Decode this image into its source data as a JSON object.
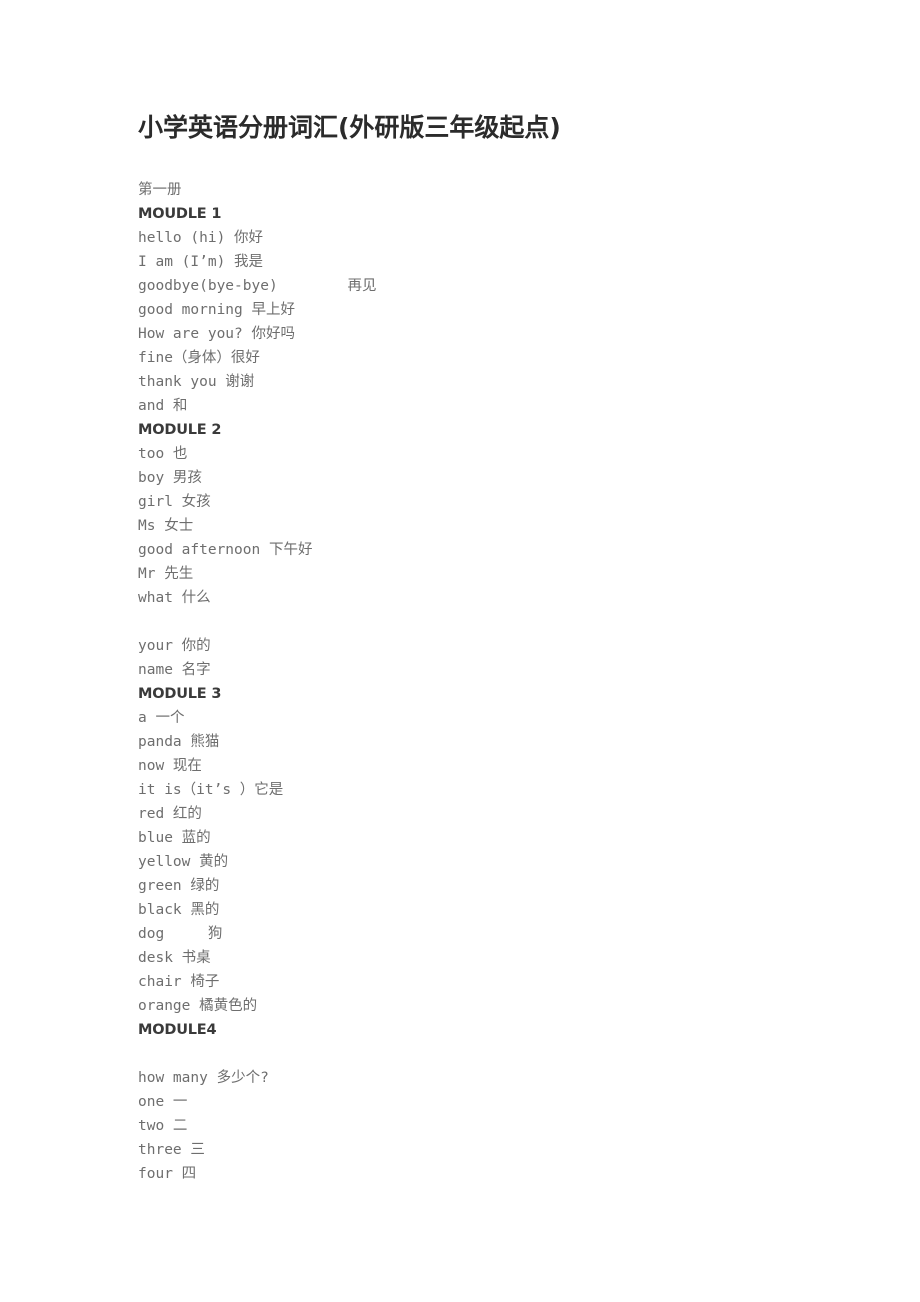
{
  "document": {
    "title": "小学英语分册词汇(外研版三年级起点)",
    "lines": [
      {
        "text": "第一册",
        "type": "normal"
      },
      {
        "text": "MOUDLE 1",
        "type": "heading"
      },
      {
        "text": "hello (hi) 你好",
        "type": "normal"
      },
      {
        "text": "I am (I’m) 我是",
        "type": "normal"
      },
      {
        "text": "goodbye(bye-bye)        再见",
        "type": "normal"
      },
      {
        "text": "good morning 早上好",
        "type": "normal"
      },
      {
        "text": "How are you? 你好吗",
        "type": "normal"
      },
      {
        "text": "fine（身体）很好",
        "type": "normal"
      },
      {
        "text": "thank you 谢谢",
        "type": "normal"
      },
      {
        "text": "and 和",
        "type": "normal"
      },
      {
        "text": "MODULE 2",
        "type": "heading"
      },
      {
        "text": "too 也",
        "type": "normal"
      },
      {
        "text": "boy 男孩",
        "type": "normal"
      },
      {
        "text": "girl 女孩",
        "type": "normal"
      },
      {
        "text": "Ms 女士",
        "type": "normal"
      },
      {
        "text": "good afternoon 下午好",
        "type": "normal"
      },
      {
        "text": "Mr 先生",
        "type": "normal"
      },
      {
        "text": "what 什么",
        "type": "normal"
      },
      {
        "text": "",
        "type": "blank"
      },
      {
        "text": "your 你的",
        "type": "normal"
      },
      {
        "text": "name 名字",
        "type": "normal"
      },
      {
        "text": "MODULE 3",
        "type": "heading"
      },
      {
        "text": "a 一个",
        "type": "normal"
      },
      {
        "text": "panda 熊猫",
        "type": "normal"
      },
      {
        "text": "now 现在",
        "type": "normal"
      },
      {
        "text": "it is（it’s ）它是",
        "type": "normal"
      },
      {
        "text": "red 红的",
        "type": "normal"
      },
      {
        "text": "blue 蓝的",
        "type": "normal"
      },
      {
        "text": "yellow 黄的",
        "type": "normal"
      },
      {
        "text": "green 绿的",
        "type": "normal"
      },
      {
        "text": "black 黑的",
        "type": "normal"
      },
      {
        "text": "dog     狗",
        "type": "normal"
      },
      {
        "text": "desk 书桌",
        "type": "normal"
      },
      {
        "text": "chair 椅子",
        "type": "normal"
      },
      {
        "text": "orange 橘黄色的",
        "type": "normal"
      },
      {
        "text": "MODULE4",
        "type": "heading"
      },
      {
        "text": "",
        "type": "blank"
      },
      {
        "text": "how many 多少个?",
        "type": "normal"
      },
      {
        "text": "one 一",
        "type": "normal"
      },
      {
        "text": "two 二",
        "type": "normal"
      },
      {
        "text": "three 三",
        "type": "normal"
      },
      {
        "text": "four 四",
        "type": "normal"
      }
    ]
  }
}
